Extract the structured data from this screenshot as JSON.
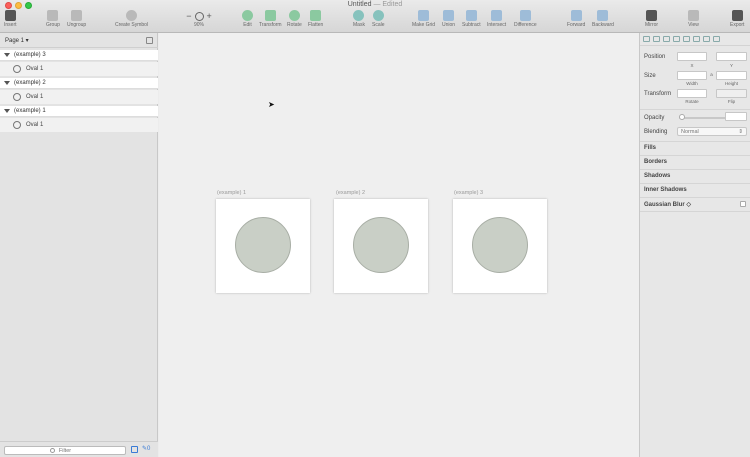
{
  "window": {
    "title": "Untitled",
    "title_suffix": "— Edited"
  },
  "toolbar": {
    "insert": "Insert",
    "group": "Group",
    "ungroup": "Ungroup",
    "create_symbol": "Create Symbol",
    "zoom_minus": "−",
    "zoom_plus": "+",
    "zoom_value": "90%",
    "edit": "Edit",
    "transform": "Transform",
    "rotate": "Rotate",
    "flatten": "Flatten",
    "mask": "Mask",
    "scale": "Scale",
    "make_grid": "Make Grid",
    "union": "Union",
    "subtract": "Subtract",
    "intersect": "Intersect",
    "difference": "Difference",
    "forward": "Forward",
    "backward": "Backward",
    "mirror": "Mirror",
    "view": "View",
    "export": "Export"
  },
  "layers": {
    "page_selector": "Page 1 ▾",
    "items": [
      {
        "artboard": "(example) 3",
        "child": "Oval 1"
      },
      {
        "artboard": "(example) 2",
        "child": "Oval 1"
      },
      {
        "artboard": "(example) 1",
        "child": "Oval 1"
      }
    ],
    "filter_placeholder": "Filter",
    "filter_count": "0"
  },
  "canvas": {
    "artboards": [
      {
        "label": "(example) 1"
      },
      {
        "label": "(example) 2"
      },
      {
        "label": "(example) 3"
      }
    ]
  },
  "inspector": {
    "position": "Position",
    "x": "X",
    "y": "Y",
    "size": "Size",
    "lock": "a",
    "width": "Width",
    "height": "Height",
    "transform": "Transform",
    "rotate": "Rotate",
    "flip": "Flip",
    "opacity": "Opacity",
    "blending": "Blending",
    "blending_value": "Normal",
    "fills": "Fills",
    "borders": "Borders",
    "shadows": "Shadows",
    "inner_shadows": "Inner Shadows",
    "gaussian_blur": "Gaussian Blur ◇"
  },
  "colors": {
    "circle_fill": "#c9cfc6",
    "accent": "#3a7bd5"
  }
}
